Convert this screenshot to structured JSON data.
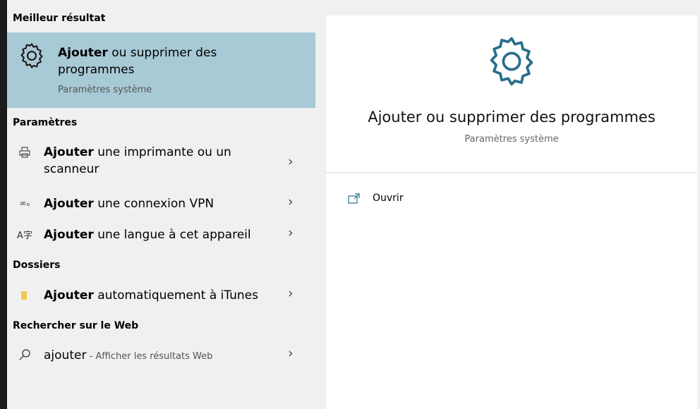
{
  "left": {
    "best_header": "Meilleur résultat",
    "best": {
      "bold": "Ajouter",
      "rest": " ou supprimer des programmes",
      "sub": "Paramètres système"
    },
    "settings_header": "Paramètres",
    "settings": [
      {
        "icon": "printer-icon",
        "bold": "Ajouter",
        "rest": " une imprimante ou un scanneur"
      },
      {
        "icon": "vpn-icon",
        "bold": "Ajouter",
        "rest": " une connexion VPN"
      },
      {
        "icon": "language-icon",
        "bold": "Ajouter",
        "rest": " une langue à cet appareil"
      }
    ],
    "folders_header": "Dossiers",
    "folders": [
      {
        "icon": "folder-icon",
        "bold": "Ajouter",
        "rest": " automatiquement à iTunes"
      }
    ],
    "web_header": "Rechercher sur le Web",
    "web": {
      "query": "ajouter",
      "suffix": " - Afficher les résultats Web"
    }
  },
  "right": {
    "title": "Ajouter ou supprimer des programmes",
    "subtitle": "Paramètres système",
    "open_label": "Ouvrir"
  },
  "colors": {
    "accent": "#2b6e8c",
    "highlight": "#a8c9d6"
  }
}
